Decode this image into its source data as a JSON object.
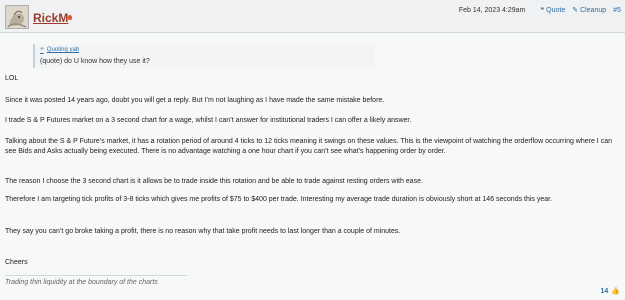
{
  "post": {
    "username": "RickM",
    "date": "Feb 14, 2023 4:29am",
    "actions": {
      "quote": "Quote",
      "cleanup": "Cleanup",
      "number": "#5"
    },
    "quote": {
      "source": "Quoting yab",
      "text": "(quote) do U know how they use it?"
    },
    "paragraphs": [
      "LOL",
      "Since it was posted 14 years ago, doubt you will get a reply. But I’m not laughing as I have made the same mistake before.",
      "I trade S & P Futures market on a 3 second chart for a wage, whilst I can’t answer for institutional traders I can offer a likely answer.",
      "Talking about the S & P Future’s market, it has a rotation period of around 4 ticks to 12 ticks meaning it swings on these values. This is the viewpoint of watching the orderflow occurring where I can see Bids and Asks actually being executed. There is no advantage watching a one hour chart if you can’t see what’s happening order by order.",
      "The reason I choose the 3 second chart is it allows be to trade inside this rotation and be able to trade against resting orders with ease.",
      "Therefore I am targeting tick profits of 3-8 ticks which gives me profits of $75 to $400 per trade. Interesting my average trade duration is obviously short at 146 seconds this year.",
      "They say you can’t go broke taking a profit, there is no reason why that take profit needs to last longer than a couple of minutes.",
      "Cheers"
    ],
    "signature": "Trading thin liquidity at the boundary of the charts",
    "likes": "14"
  },
  "colors": {
    "username": "#9a3b2e",
    "link": "#2d6ea6"
  }
}
